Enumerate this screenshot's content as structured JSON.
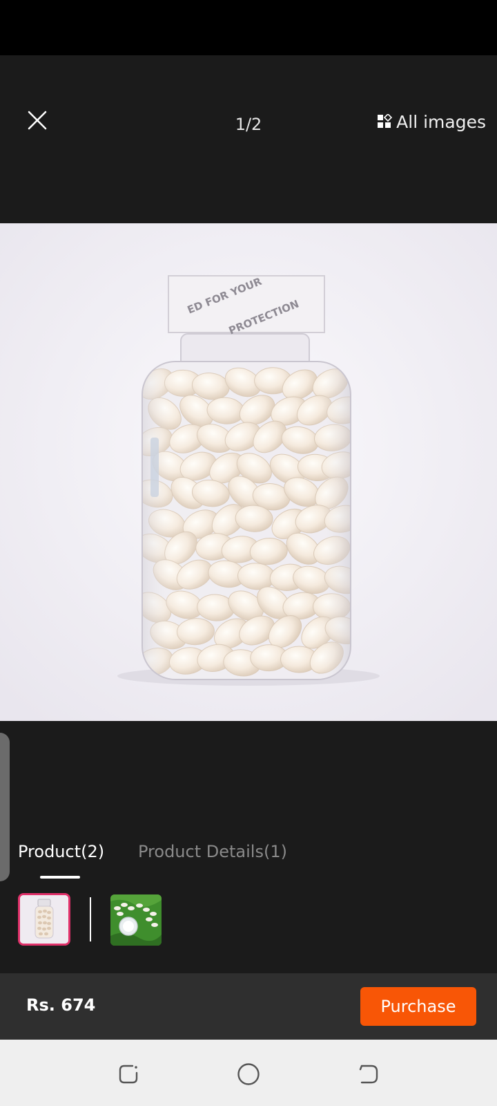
{
  "viewer": {
    "counter": "1/2",
    "all_images_label": "All images"
  },
  "tabs": [
    {
      "label": "Product(2)",
      "active": true
    },
    {
      "label": "Product Details(1)",
      "active": false
    }
  ],
  "product": {
    "price": "Rs. 674",
    "purchase_label": "Purchase"
  },
  "image_text": {
    "seal_line_1": "ED FOR YOUR",
    "seal_line_2": "PROTECTION"
  },
  "colors": {
    "accent": "#f85606",
    "thumb_selected_border": "#e0316a",
    "background": "#1b1b1b"
  },
  "icons": {
    "close": "close-icon",
    "all_images": "grid-icon",
    "nav_recent": "recent-apps-icon",
    "nav_home": "home-icon",
    "nav_back": "back-icon"
  }
}
